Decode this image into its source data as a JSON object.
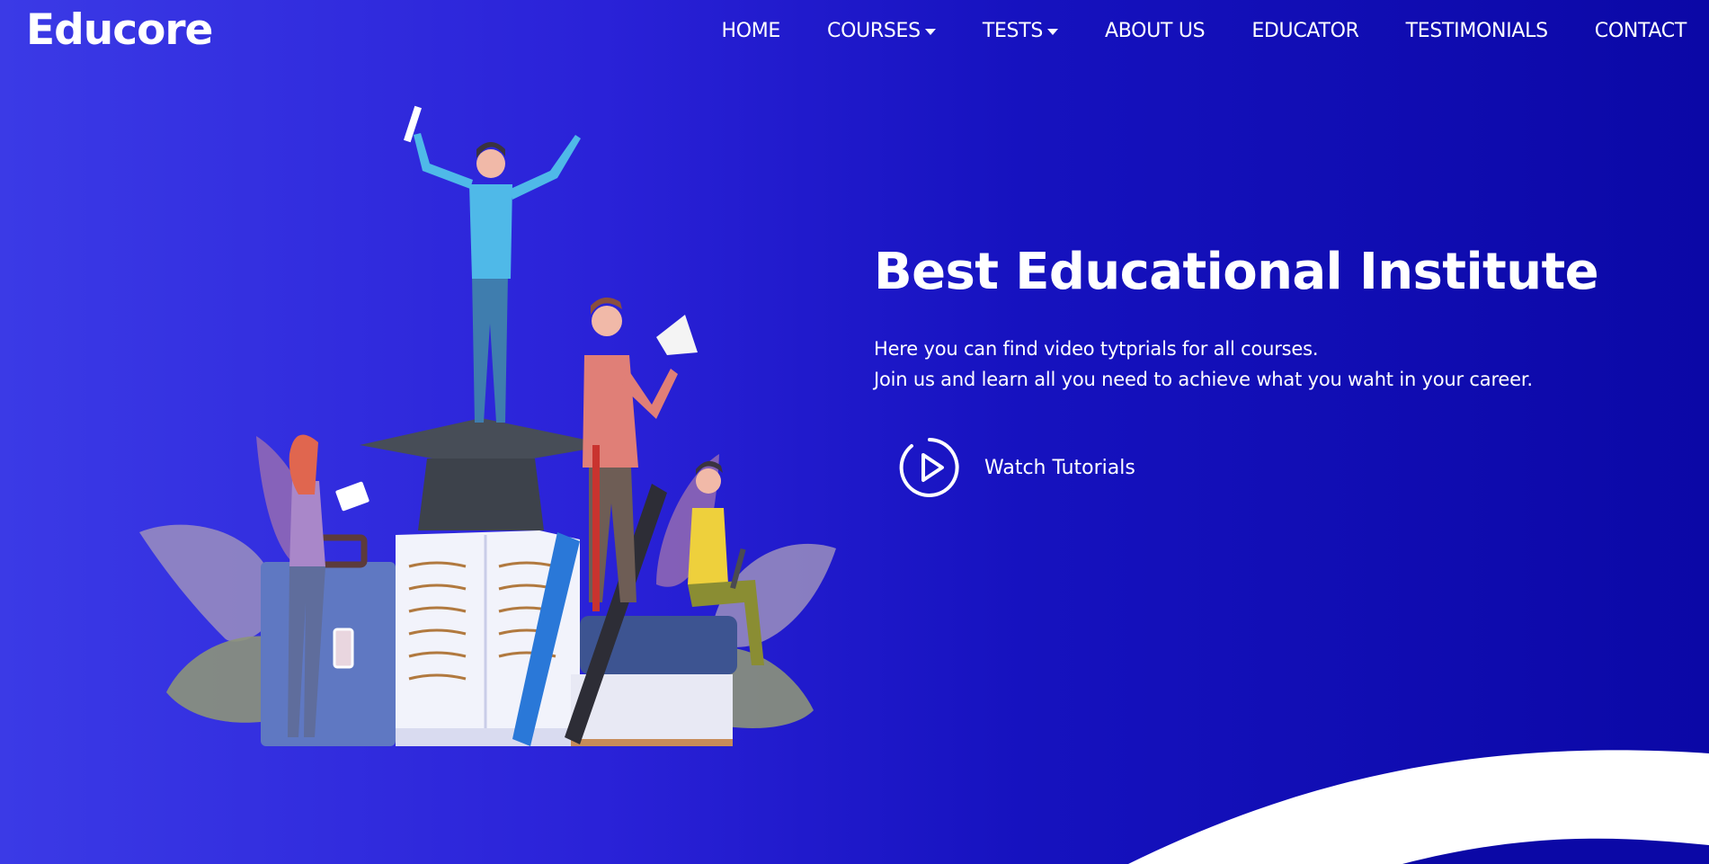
{
  "brand": "Educore",
  "nav": {
    "home": "HOME",
    "courses": "COURSES",
    "tests": "TESTS",
    "about": "ABOUT US",
    "educator": "EDUCATOR",
    "testimonials": "TESTIMONIALS",
    "contact": "CONTACT"
  },
  "hero": {
    "title": "Best Educational Institute",
    "line1": "Here you can find video tytprials for all courses.",
    "line2": "Join us and learn all you need to achieve what you waht in your career.",
    "cta": "Watch Tutorials"
  },
  "icons": {
    "dropdown": "caret-down-icon",
    "play": "play-circle-icon"
  },
  "colors": {
    "gradient_start": "#3b3ae6",
    "gradient_end": "#0b08a6",
    "text": "#ffffff"
  }
}
